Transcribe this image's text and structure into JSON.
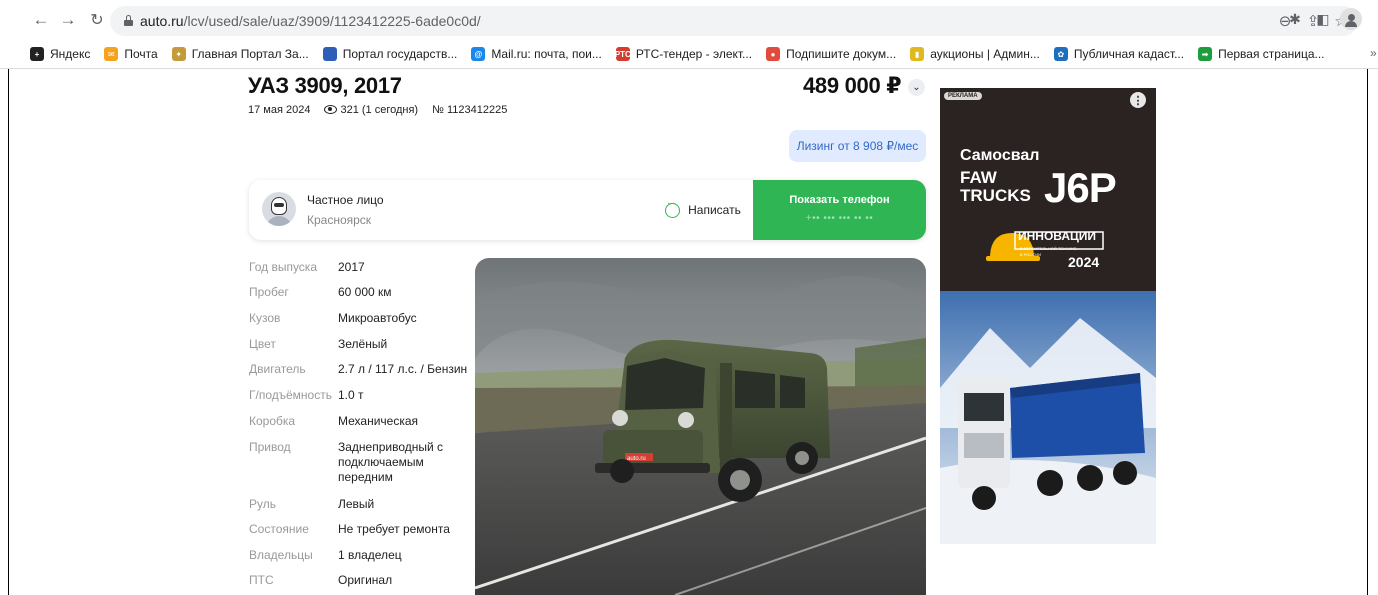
{
  "browser": {
    "url_host": "auto.ru",
    "url_path": "/lcv/used/sale/uaz/3909/1123412225-6ade0c0d/",
    "bookmarks": [
      {
        "label": "Яндекс",
        "color": "#222222",
        "glyph": "+"
      },
      {
        "label": "Почта",
        "color": "#f6a21e",
        "glyph": "✉"
      },
      {
        "label": "Главная Портал За...",
        "color": "#c49a3a",
        "glyph": "✦"
      },
      {
        "label": "Портал государств...",
        "color": "#2d5fb6",
        "glyph": ""
      },
      {
        "label": "Mail.ru: почта, пои...",
        "color": "#1a88e8",
        "glyph": "@"
      },
      {
        "label": "РТС-тендер - элект...",
        "color": "#d33c2e",
        "glyph": "РТС"
      },
      {
        "label": "Подпишите докум...",
        "color": "#e24b3b",
        "glyph": "●"
      },
      {
        "label": "аукционы | Админ...",
        "color": "#e0b81f",
        "glyph": "▮"
      },
      {
        "label": "Публичная кадаст...",
        "color": "#1f6fbf",
        "glyph": "✿"
      },
      {
        "label": "Первая страница...",
        "color": "#1d9d3b",
        "glyph": "➡"
      }
    ],
    "more": "»"
  },
  "listing": {
    "title": "УАЗ 3909, 2017",
    "price": "489 000 ₽",
    "date": "17 мая 2024",
    "views": "321 (1 сегодня)",
    "number": "№ 1123412225",
    "leasing": "Лизинг от 8 908 ₽/мес",
    "seller": {
      "name": "Частное лицо",
      "city": "Красноярск",
      "write": "Написать",
      "show_phone": "Показать телефон",
      "phone_masked": "+•• ••• ••• •• ••"
    },
    "specs": [
      {
        "key": "Год выпуска",
        "value": "2017"
      },
      {
        "key": "Пробег",
        "value": "60 000 км"
      },
      {
        "key": "Кузов",
        "value": "Микроавтобус"
      },
      {
        "key": "Цвет",
        "value": "Зелёный"
      },
      {
        "key": "Двигатель",
        "value": "2.7 л / 117 л.с. / Бензин"
      },
      {
        "key": "Г/подъёмность",
        "value": "1.0 т"
      },
      {
        "key": "Коробка",
        "value": "Механическая"
      },
      {
        "key": "Привод",
        "value": "Заднеприводный с подключаемым передним"
      },
      {
        "key": "Руль",
        "value": "Левый"
      },
      {
        "key": "Состояние",
        "value": "Не требует ремонта"
      },
      {
        "key": "Владельцы",
        "value": "1 владелец"
      },
      {
        "key": "ПТС",
        "value": "Оригинал"
      }
    ],
    "plate": "auto.ru"
  },
  "ad": {
    "badge": "РЕКЛАМА",
    "headline": "Самосвал",
    "brand_line1": "FAW",
    "brand_line2": "TRUCKS",
    "model": "J6P",
    "award_title": "ИННОВАЦИИ",
    "award_sub1": "В СТРОИТЕЛЬНОЙ ТЕХНИКЕ",
    "award_sub2": "В РОССИИ",
    "award_year": "2024"
  },
  "colors": {
    "accent_green": "#2fb553",
    "leasing_bg": "#e0ebff",
    "leasing_text": "#3469c3",
    "ad_dark": "#2a2321"
  }
}
